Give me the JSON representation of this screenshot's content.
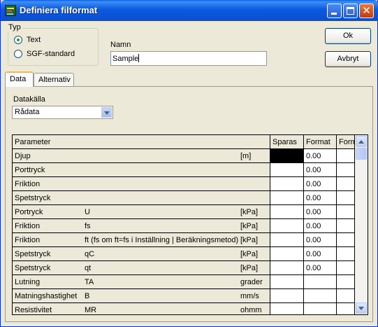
{
  "window": {
    "title": "Definiera filformat",
    "icon": "app-icon",
    "controls": [
      "minimize-icon",
      "maximize-icon",
      "close-icon"
    ]
  },
  "type_group": {
    "legend": "Typ",
    "options": [
      {
        "label": "Text",
        "selected": true
      },
      {
        "label": "SGF-standard",
        "selected": false
      }
    ]
  },
  "name": {
    "label": "Namn",
    "value": "Sample"
  },
  "buttons": {
    "ok": "Ok",
    "cancel": "Avbryt"
  },
  "tabs": [
    {
      "label": "Data",
      "active": true
    },
    {
      "label": "Alternativ",
      "active": false
    }
  ],
  "datasource": {
    "label": "Datakälla",
    "value": "Rådata"
  },
  "table": {
    "headers": {
      "parameter": "Parameter",
      "sparas": "Sparas",
      "format": "Format",
      "format2": "Form"
    },
    "rows": [
      {
        "name": "Djup",
        "symbol": "",
        "unit": "[m]",
        "sparas": "",
        "sparas_filled": true,
        "format": "0.00",
        "format2": ""
      },
      {
        "name": "Porttryck",
        "symbol": "",
        "unit": "",
        "sparas": "",
        "sparas_filled": false,
        "format": "0.00",
        "format2": ""
      },
      {
        "name": "Friktion",
        "symbol": "",
        "unit": "",
        "sparas": "",
        "sparas_filled": false,
        "format": "0.00",
        "format2": ""
      },
      {
        "name": "Spetstryck",
        "symbol": "",
        "unit": "",
        "sparas": "",
        "sparas_filled": false,
        "format": "0.00",
        "format2": ""
      },
      {
        "name": "Portryck",
        "symbol": "U",
        "unit": "[kPa]",
        "sparas": "",
        "sparas_filled": false,
        "format": "0.00",
        "format2": ""
      },
      {
        "name": "Friktion",
        "symbol": "fs",
        "unit": "[kPa]",
        "sparas": "",
        "sparas_filled": false,
        "format": "0.00",
        "format2": ""
      },
      {
        "name": "Friktion",
        "symbol": "ft (fs om ft=fs i Inställning | Beräkningsmetod)",
        "unit": "[kPa]",
        "sparas": "",
        "sparas_filled": false,
        "format": "0.00",
        "format2": ""
      },
      {
        "name": "Spetstryck",
        "symbol": "qC",
        "unit": "[kPa]",
        "sparas": "",
        "sparas_filled": false,
        "format": "0.00",
        "format2": ""
      },
      {
        "name": "Spetstryck",
        "symbol": "qt",
        "unit": "[kPa]",
        "sparas": "",
        "sparas_filled": false,
        "format": "0.00",
        "format2": ""
      },
      {
        "name": "Lutning",
        "symbol": "TA",
        "unit": "grader",
        "sparas": "",
        "sparas_filled": false,
        "format": "",
        "format2": ""
      },
      {
        "name": "Matningshastighet",
        "symbol": "B",
        "unit": "mm/s",
        "sparas": "",
        "sparas_filled": false,
        "format": "",
        "format2": ""
      },
      {
        "name": "Resistivitet",
        "symbol": "MR",
        "unit": "ohmm",
        "sparas": "",
        "sparas_filled": false,
        "format": "",
        "format2": ""
      }
    ]
  }
}
